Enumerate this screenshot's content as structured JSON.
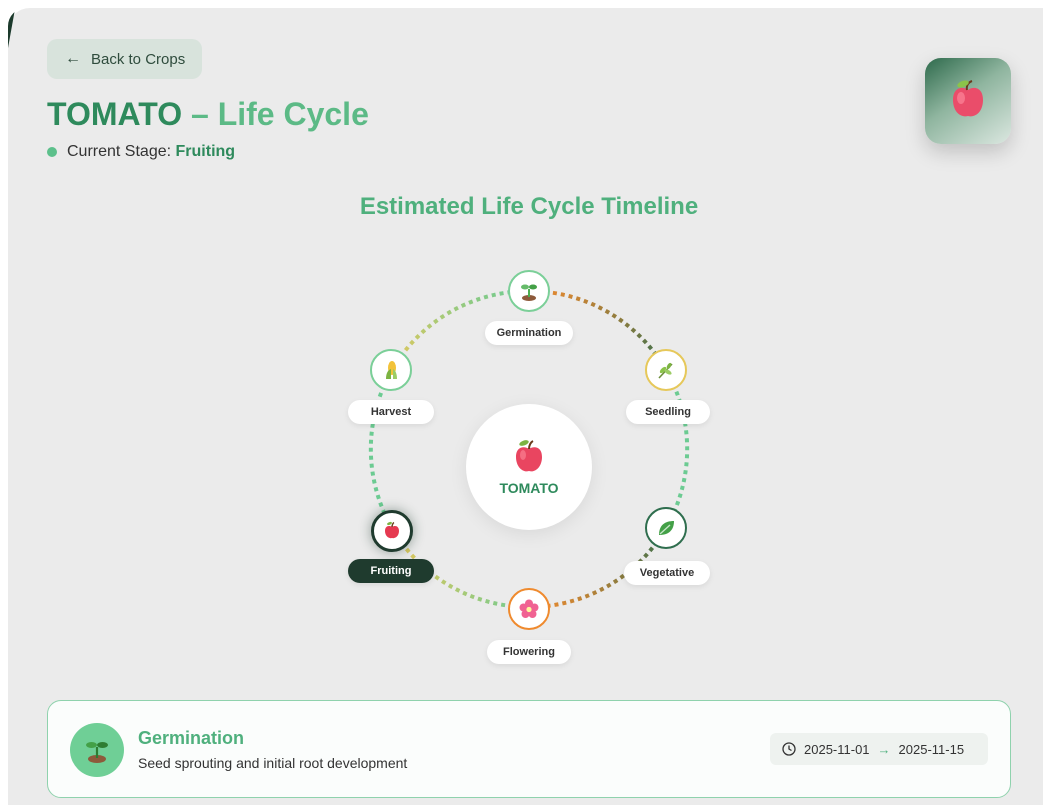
{
  "header": {
    "back_label": "Back to Crops",
    "title_crop": "TOMATO",
    "title_sep": " – ",
    "title_rest": "Life Cycle",
    "current_stage_label": "Current Stage:",
    "current_stage_value": "Fruiting"
  },
  "timeline": {
    "title": "Estimated Life Cycle Timeline",
    "center_label": "TOMATO",
    "stages": [
      {
        "label": "Germination",
        "icon": "sprout-icon",
        "ring": "#7bcf98"
      },
      {
        "label": "Seedling",
        "icon": "seedling-leaves-icon",
        "ring": "#e6c85a"
      },
      {
        "label": "Vegetative",
        "icon": "leaf-icon",
        "ring": "#2f6e4e"
      },
      {
        "label": "Flowering",
        "icon": "blossom-icon",
        "ring": "#ef8a2e"
      },
      {
        "label": "Fruiting",
        "icon": "apple-icon",
        "ring": "#1f3b2e"
      },
      {
        "label": "Harvest",
        "icon": "corn-icon",
        "ring": "#7bcf98"
      }
    ],
    "active_stage": "Fruiting"
  },
  "detail": {
    "title": "Germination",
    "description": "Seed sprouting and initial root development",
    "start": "2025-11-01",
    "arrow": "→",
    "end": "2025-11-15"
  },
  "colors": {
    "accent": "#4fb07d",
    "accent_dark": "#2e8a5c",
    "active_dark": "#1f3b2e"
  }
}
